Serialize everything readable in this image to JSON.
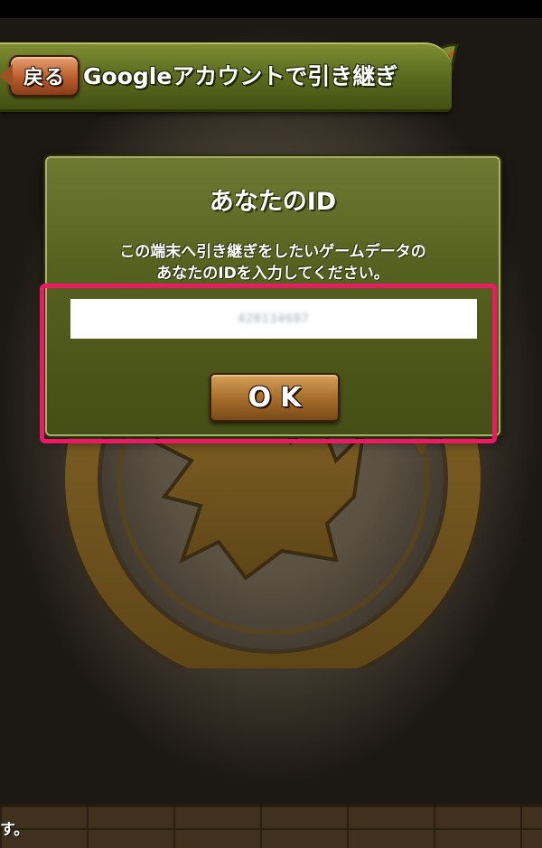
{
  "header": {
    "back_label": "戻る",
    "title": "Googleアカウントで引き継ぎ"
  },
  "dialog": {
    "title": "あなたのID",
    "message_line1": "この端末へ引き継ぎをしたいゲームデータの",
    "message_line2": "あなたのIDを入力してください。",
    "id_value": "420134687",
    "ok_label": "OK"
  },
  "footer": {
    "text": "す。"
  },
  "colors": {
    "header_green": "#5e6d20",
    "dialog_green": "#56611f",
    "highlight": "#ec1a63",
    "button_brown": "#a96f2c"
  }
}
